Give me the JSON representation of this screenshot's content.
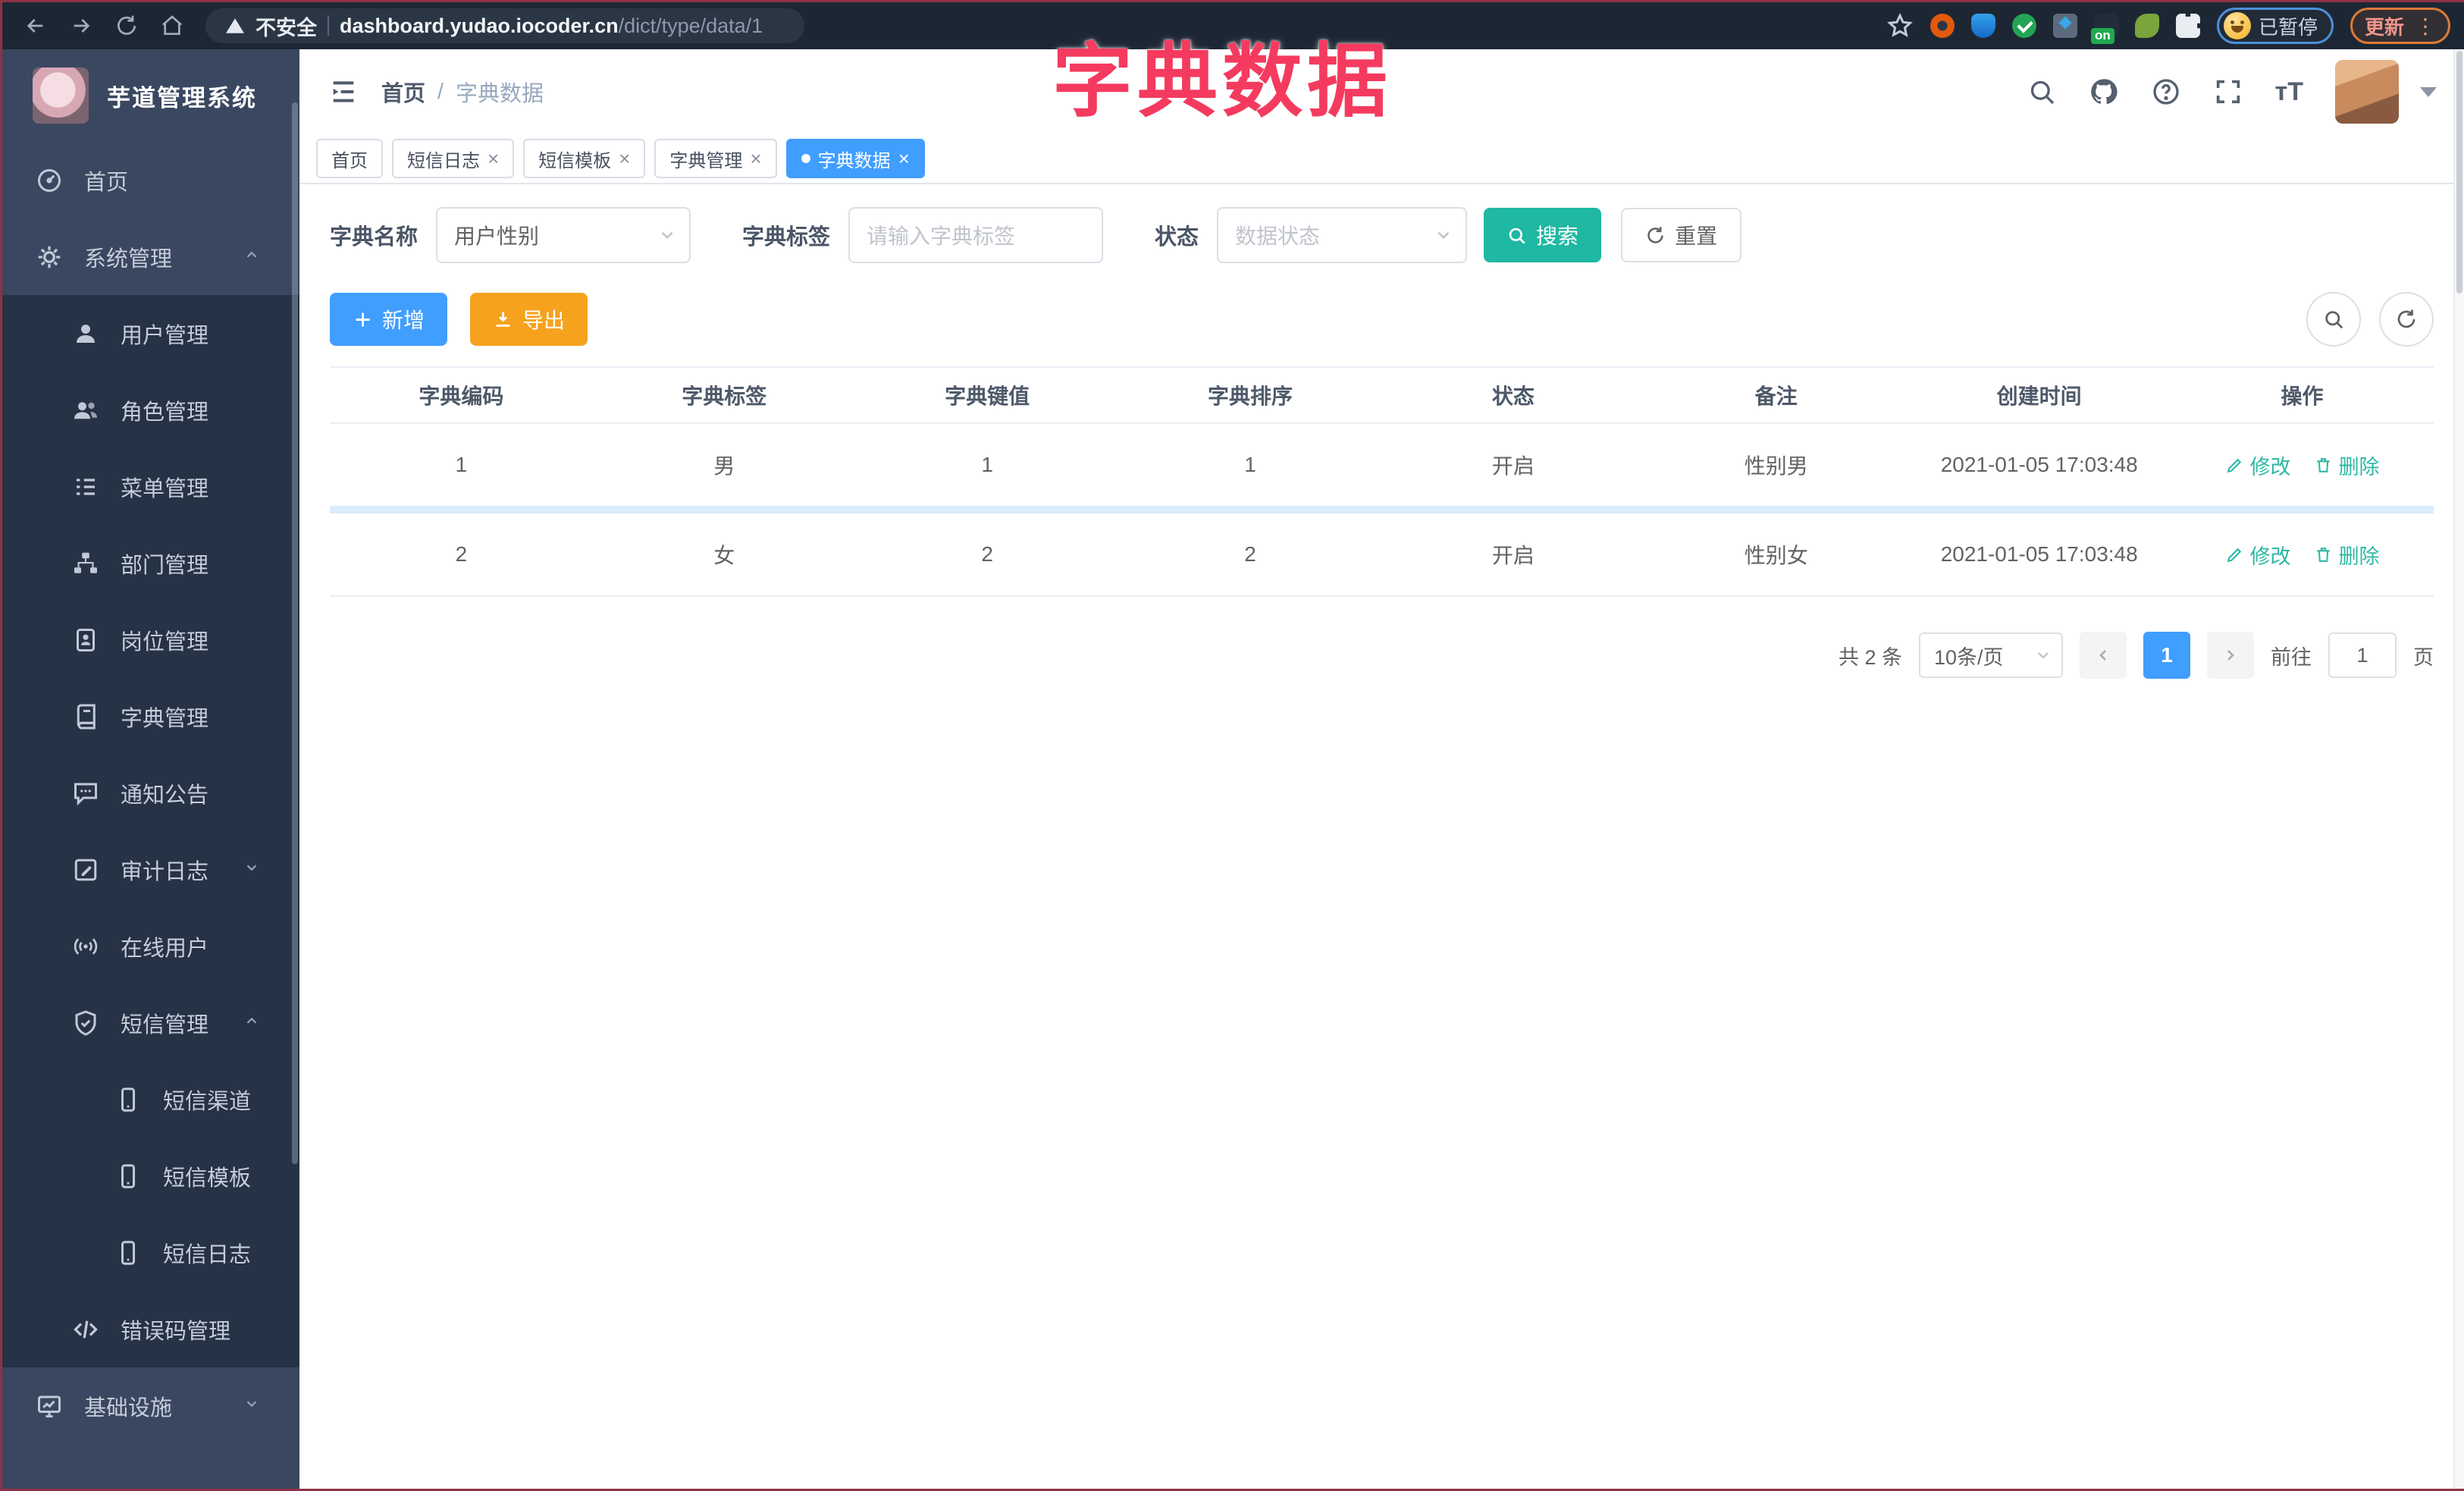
{
  "browser": {
    "security_label": "不安全",
    "url_host": "dashboard.yudao.iocoder.cn",
    "url_path": "/dict/type/data/1",
    "on_badge": "on",
    "paused_label": "已暂停",
    "update_label": "更新",
    "menu_dots": "⋮"
  },
  "overlay_title": "字典数据",
  "sidebar": {
    "app_title": "芋道管理系统",
    "menu": [
      {
        "label": "首页",
        "icon": "dashboard-icon",
        "level": 1
      },
      {
        "label": "系统管理",
        "icon": "gear-icon",
        "level": 1,
        "arrow": "up"
      },
      {
        "label": "用户管理",
        "icon": "user-icon",
        "level": 2
      },
      {
        "label": "角色管理",
        "icon": "users-icon",
        "level": 2
      },
      {
        "label": "菜单管理",
        "icon": "menu-list-icon",
        "level": 2
      },
      {
        "label": "部门管理",
        "icon": "org-tree-icon",
        "level": 2
      },
      {
        "label": "岗位管理",
        "icon": "id-badge-icon",
        "level": 2
      },
      {
        "label": "字典管理",
        "icon": "dictionary-icon",
        "level": 2
      },
      {
        "label": "通知公告",
        "icon": "announcement-icon",
        "level": 2
      },
      {
        "label": "审计日志",
        "icon": "audit-log-icon",
        "level": 2,
        "arrow": "down"
      },
      {
        "label": "在线用户",
        "icon": "online-users-icon",
        "level": 2
      },
      {
        "label": "短信管理",
        "icon": "shield-check-icon",
        "level": 2,
        "arrow": "up"
      },
      {
        "label": "短信渠道",
        "icon": "phone-icon",
        "level": 3
      },
      {
        "label": "短信模板",
        "icon": "phone-icon",
        "level": 3
      },
      {
        "label": "短信日志",
        "icon": "phone-icon",
        "level": 3
      },
      {
        "label": "错误码管理",
        "icon": "code-icon",
        "level": 2
      },
      {
        "label": "基础设施",
        "icon": "infrastructure-icon",
        "level": 1,
        "arrow": "down"
      }
    ]
  },
  "header": {
    "breadcrumb": [
      "首页",
      "字典数据"
    ],
    "breadcrumb_separator": "/"
  },
  "tabs": [
    {
      "label": "首页",
      "closable": false,
      "active": false
    },
    {
      "label": "短信日志",
      "closable": true,
      "active": false
    },
    {
      "label": "短信模板",
      "closable": true,
      "active": false
    },
    {
      "label": "字典管理",
      "closable": true,
      "active": false
    },
    {
      "label": "字典数据",
      "closable": true,
      "active": true
    }
  ],
  "filters": {
    "dict_name_label": "字典名称",
    "dict_name_value": "用户性别",
    "dict_label_label": "字典标签",
    "dict_label_placeholder": "请输入字典标签",
    "status_label": "状态",
    "status_placeholder": "数据状态",
    "search_label": "搜索",
    "reset_label": "重置"
  },
  "toolbar": {
    "add_label": "新增",
    "export_label": "导出"
  },
  "table": {
    "columns": [
      "字典编码",
      "字典标签",
      "字典键值",
      "字典排序",
      "状态",
      "备注",
      "创建时间",
      "操作"
    ],
    "rows": [
      {
        "code": "1",
        "label": "男",
        "value": "1",
        "sort": "1",
        "status": "开启",
        "remark": "性别男",
        "created": "2021-01-05 17:03:48"
      },
      {
        "code": "2",
        "label": "女",
        "value": "2",
        "sort": "2",
        "status": "开启",
        "remark": "性别女",
        "created": "2021-01-05 17:03:48"
      }
    ],
    "action_edit": "修改",
    "action_delete": "删除"
  },
  "pagination": {
    "total": "共 2 条",
    "page_size": "10条/页",
    "page": "1",
    "goto": "前往",
    "goto_value": "1",
    "unit": "页"
  },
  "colors": {
    "primary": "#409EFF",
    "teal": "#1fb8a2",
    "orange": "#f6a21e",
    "annotation_pink": "#f43b5f",
    "sidebar_bg": "#3a4760",
    "submenu_bg": "#263246"
  }
}
